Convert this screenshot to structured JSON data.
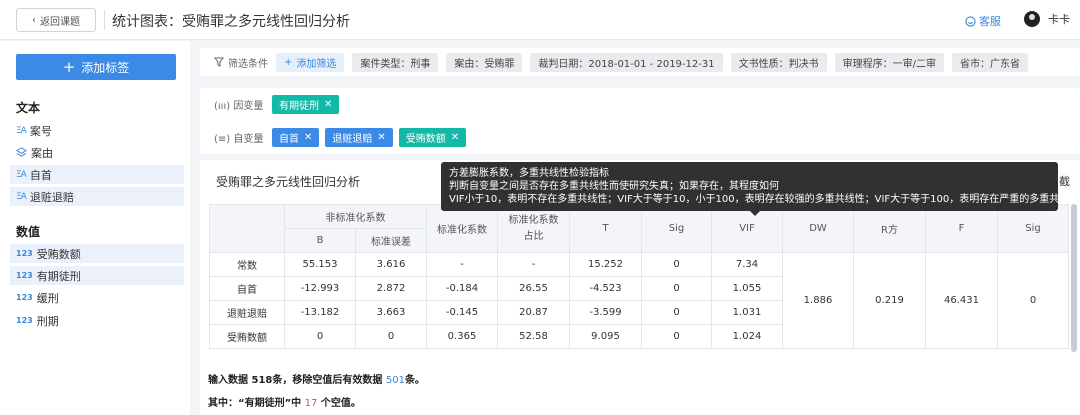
{
  "header": {
    "back_label": "返回课题",
    "title": "统计图表：受贿罪之多元线性回归分析",
    "service_label": "客服",
    "user_name": "卡卡"
  },
  "sidebar": {
    "add_tag_label": "添加标签",
    "text_section": "文本",
    "text_items": [
      {
        "icon": "ΞA",
        "label": "案号",
        "active": false
      },
      {
        "icon": "layers",
        "label": "案由",
        "active": false
      },
      {
        "icon": "ΞA",
        "label": "自首",
        "active": true
      },
      {
        "icon": "ΞA",
        "label": "退赃退赔",
        "active": true
      }
    ],
    "number_section": "数值",
    "number_items": [
      {
        "icon": "123",
        "label": "受贿数额",
        "active": true
      },
      {
        "icon": "123",
        "label": "有期徒刑",
        "active": true
      },
      {
        "icon": "123",
        "label": "缓刑",
        "active": false
      },
      {
        "icon": "123",
        "label": "刑期",
        "active": false
      }
    ]
  },
  "filters": {
    "label": "筛选条件",
    "add_label": "添加筛选",
    "chips": [
      "案件类型：刑事",
      "案由：受贿罪",
      "裁判日期：2018-01-01 - 2019-12-31",
      "文书性质：判决书",
      "审理程序：一审/二审",
      "省市：广东省"
    ]
  },
  "variables": {
    "dependent_label": "因变量",
    "dependent": [
      "有期徒刑"
    ],
    "independent_label": "自变量",
    "independent": [
      {
        "label": "自首",
        "color": "#3b8ae6"
      },
      {
        "label": "退赃退赔",
        "color": "#3b8ae6"
      },
      {
        "label": "受贿数额",
        "color": "#14b8a6"
      }
    ]
  },
  "panel": {
    "title": "受贿罪之多元线性回归分析",
    "right_text": "截"
  },
  "tooltip": {
    "lines": [
      "方差膨胀系数，多重共线性检验指标",
      "判断自变量之间是否存在多重共线性而使研究失真；如果存在，其程度如何",
      "VIF小于10，表明不存在多重共线性；VIF大于等于10，小于100，表明存在较强的多重共线性；VIF大于等于100，表明存在严重的多重共线性"
    ]
  },
  "table": {
    "header_group": "非标准化系数",
    "header_b": "B",
    "header_se": "标准误差",
    "header_beta": "标准化系数",
    "header_ratio_1": "标准化系数",
    "header_ratio_2": "占比",
    "header_t": "T",
    "header_sig": "Sig",
    "header_vif": "VIF",
    "header_dw": "DW",
    "header_r2": "R方",
    "header_f": "F",
    "header_sig2": "Sig",
    "rows": [
      {
        "name": "常数",
        "b": "55.153",
        "se": "3.616",
        "beta": "-",
        "ratio": "-",
        "t": "15.252",
        "sig": "0",
        "vif": "7.34"
      },
      {
        "name": "自首",
        "b": "-12.993",
        "se": "2.872",
        "beta": "-0.184",
        "ratio": "26.55",
        "t": "-4.523",
        "sig": "0",
        "vif": "1.055"
      },
      {
        "name": "退赃退赔",
        "b": "-13.182",
        "se": "3.663",
        "beta": "-0.145",
        "ratio": "20.87",
        "t": "-3.599",
        "sig": "0",
        "vif": "1.031"
      },
      {
        "name": "受贿数额",
        "b": "0",
        "se": "0",
        "beta": "0.365",
        "ratio": "52.58",
        "t": "9.095",
        "sig": "0",
        "vif": "1.024"
      }
    ],
    "dw": "1.886",
    "r2": "0.219",
    "f": "46.431",
    "sig2": "0"
  },
  "notes": {
    "line1_prefix": "输入数据 ",
    "line1_input": "518",
    "line1_mid": "条，移除空值后有效数据 ",
    "line1_valid": "501",
    "line1_suffix": "条。",
    "line2_prefix": "其中：“有期徒刑”中 ",
    "line2_count": "17",
    "line2_suffix": " 个空值。"
  }
}
